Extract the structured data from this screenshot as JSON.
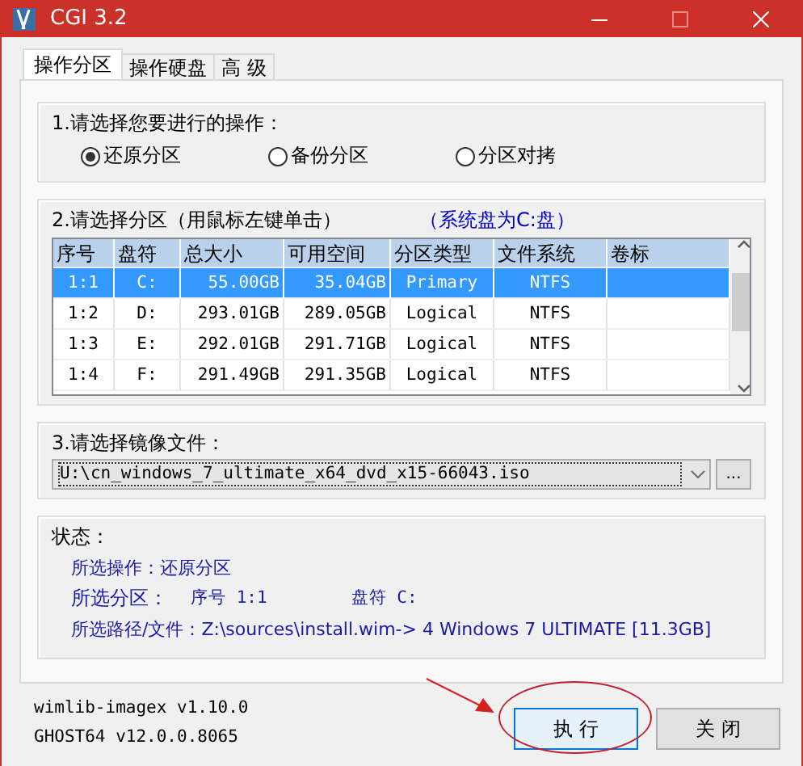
{
  "window": {
    "title": "CGI 3.2"
  },
  "tabs": [
    {
      "label": "操作分区",
      "selected": true
    },
    {
      "label": "操作硬盘",
      "selected": false
    },
    {
      "label": "高 级",
      "selected": false
    }
  ],
  "operation": {
    "label": "1.请选择您要进行的操作：",
    "options": [
      {
        "label": "还原分区",
        "selected": true
      },
      {
        "label": "备份分区",
        "selected": false
      },
      {
        "label": "分区对拷",
        "selected": false
      }
    ]
  },
  "partitions": {
    "label": "2.请选择分区（用鼠标左键单击）",
    "system_note": "（系统盘为C:盘）",
    "columns": [
      "序号",
      "盘符",
      "总大小",
      "可用空间",
      "分区类型",
      "文件系统",
      "卷标"
    ],
    "rows": [
      {
        "cells": [
          "1:1",
          "C:",
          "55.00GB",
          "35.04GB",
          "Primary",
          "NTFS"
        ],
        "selected": true
      },
      {
        "cells": [
          "1:2",
          "D:",
          "293.01GB",
          "289.05GB",
          "Logical",
          "NTFS"
        ],
        "selected": false
      },
      {
        "cells": [
          "1:3",
          "E:",
          "292.01GB",
          "291.71GB",
          "Logical",
          "NTFS"
        ],
        "selected": false
      },
      {
        "cells": [
          "1:4",
          "F:",
          "291.49GB",
          "291.35GB",
          "Logical",
          "NTFS"
        ],
        "selected": false
      }
    ]
  },
  "image_file": {
    "label": "3.请选择镜像文件：",
    "value": "U:\\cn_windows_7_ultimate_x64_dvd_x15-66043.iso",
    "browse": "..."
  },
  "status": {
    "label": "状态：",
    "lines": [
      {
        "parts": [
          "所选操作：还原分区"
        ]
      },
      {
        "parts": [
          "所选分区：",
          "序号 1:1",
          "盘符 C:"
        ]
      },
      {
        "parts": [
          "所选路径/文件：Z:\\sources\\install.wim-> 4  Windows 7 ULTIMATE [11.3GB]"
        ]
      }
    ]
  },
  "versions": [
    "wimlib-imagex v1.10.0",
    "GHOST64 v12.0.0.8065"
  ],
  "buttons": [
    {
      "label": "执 行",
      "kind": "primary"
    },
    {
      "label": "关 闭",
      "kind": "normal"
    }
  ]
}
